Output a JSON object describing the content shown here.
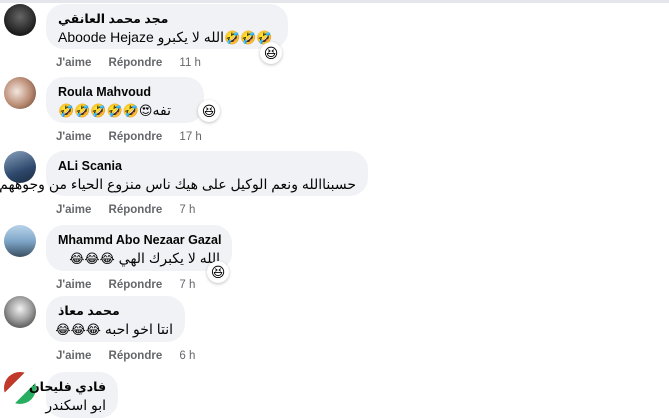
{
  "comments": [
    {
      "name": "مجد محمد العانقي",
      "text": "Aboode Hejaze الله لا يكبرو",
      "emoji": "🤣🤣🤣",
      "like_label": "J'aime",
      "reply_label": "Répondre",
      "time": "11 h",
      "reaction": "😆",
      "avatar_colors": [
        "#1c1c1c",
        "#555555"
      ]
    },
    {
      "name": "Roula Mahvoud",
      "text": "تفه",
      "emoji": "😍🤣🤣🤣🤣🤣",
      "like_label": "J'aime",
      "reply_label": "Répondre",
      "time": "17 h",
      "reaction": "😆",
      "avatar_colors": [
        "#e8d9d0",
        "#a67c66"
      ]
    },
    {
      "name": "ALi Scania",
      "text": "حسبناالله ونعم الوكيل على هيك ناس منزوع الحياء من وجوههم",
      "emoji": "",
      "like_label": "J'aime",
      "reply_label": "Répondre",
      "time": "7 h",
      "reaction": "",
      "avatar_colors": [
        "#2f4a6e",
        "#8aa2bd"
      ]
    },
    {
      "name": "Mhammd Abo Nezaar Gazal",
      "text": "الله لا يكبرك الهي",
      "emoji": "😂😂😂",
      "like_label": "J'aime",
      "reply_label": "Répondre",
      "time": "7 h",
      "reaction": "😆",
      "avatar_colors": [
        "#7fa7c9",
        "#3a4f62"
      ]
    },
    {
      "name": "محمد معاذ",
      "text": "انتا اخو احبه",
      "emoji": "😂😂😂",
      "like_label": "J'aime",
      "reply_label": "Répondre",
      "time": "6 h",
      "reaction": "",
      "avatar_colors": [
        "#d9d9d9",
        "#3b3b3b"
      ]
    },
    {
      "name": "فادي فليحان",
      "text": "ابو اسكندر",
      "emoji": "",
      "like_label": "",
      "reply_label": "",
      "time": "",
      "reaction": "",
      "avatar_colors": [
        "#c0392b",
        "#27ae60"
      ]
    }
  ]
}
